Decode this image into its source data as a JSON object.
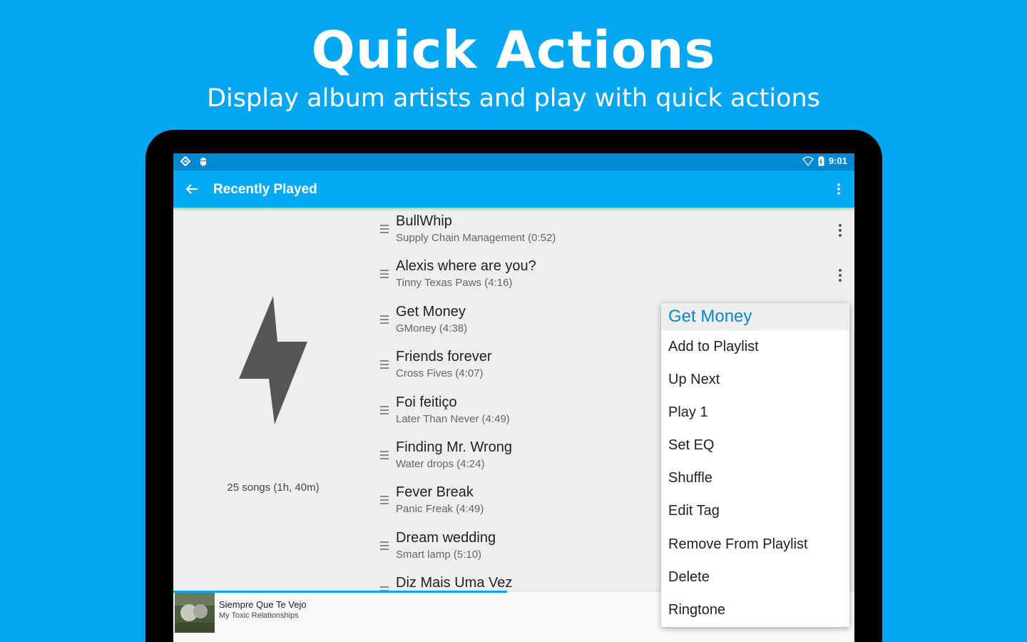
{
  "promo": {
    "title": "Quick Actions",
    "subtitle": "Display album artists and play with quick actions"
  },
  "status_bar": {
    "time": "9:01",
    "icons": [
      "location-icon",
      "android-icon",
      "wifi-icon",
      "battery-icon"
    ]
  },
  "app_bar": {
    "title": "Recently Played",
    "back_icon": "arrow-left-icon",
    "menu_icon": "more-vert-icon"
  },
  "playlist": {
    "summary": "25 songs (1h, 40m)",
    "art_icon": "lightning-bolt-icon"
  },
  "songs": [
    {
      "title": "BullWhip",
      "subtitle": "Supply Chain Management (0:52)"
    },
    {
      "title": "Alexis where are you?",
      "subtitle": "Tinny Texas Paws (4:16)"
    },
    {
      "title": "Get Money",
      "subtitle": "GMoney (4:38)"
    },
    {
      "title": "Friends forever",
      "subtitle": "Cross Fives (4:07)"
    },
    {
      "title": "Foi feitiço",
      "subtitle": "Later Than Never (4:49)"
    },
    {
      "title": "Finding Mr. Wrong",
      "subtitle": "Water drops (4:24)"
    },
    {
      "title": "Fever Break",
      "subtitle": "Panic Freak (4:49)"
    },
    {
      "title": "Dream wedding",
      "subtitle": "Smart lamp (5:10)"
    },
    {
      "title": "Diz Mais Uma Vez",
      "subtitle": ""
    }
  ],
  "now_playing": {
    "title": "Siempre Que Te Vejo",
    "artist": "My Toxic Relationships",
    "progress_fraction": 0.49
  },
  "quick_menu": {
    "header": "Get Money",
    "items": [
      "Add to Playlist",
      "Up Next",
      "Play 1",
      "Set EQ",
      "Shuffle",
      "Edit Tag",
      "Remove From Playlist",
      "Delete",
      "Ringtone"
    ]
  },
  "colors": {
    "background": "#03a6f0",
    "app_bar": "#03a9f4",
    "status_bar": "#0288d1",
    "accent": "#0288d1"
  }
}
